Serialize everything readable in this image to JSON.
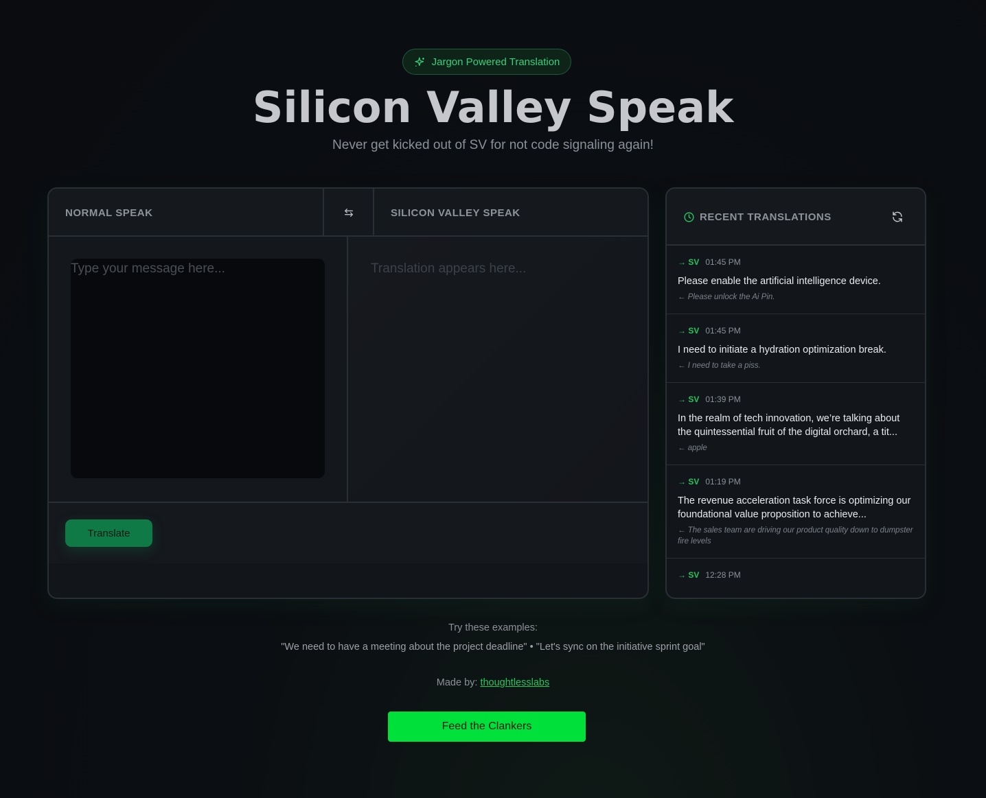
{
  "badge": {
    "label": "Jargon Powered Translation"
  },
  "header": {
    "title": "Silicon Valley Speak",
    "subtitle": "Never get kicked out of SV for not code signaling again!"
  },
  "translator": {
    "left_label": "NORMAL SPEAK",
    "right_label": "SILICON VALLEY SPEAK",
    "input_placeholder": "Type your message here...",
    "output_placeholder": "Translation appears here...",
    "translate_label": "Translate"
  },
  "recent": {
    "title": "RECENT TRANSLATIONS",
    "items": [
      {
        "tag": "→ SV",
        "time": "01:45 PM",
        "text": "Please enable the artificial intelligence device.",
        "original": "← Please unlock the Ai Pin."
      },
      {
        "tag": "→ SV",
        "time": "01:45 PM",
        "text": "I need to initiate a hydration optimization break.",
        "original": "← I need to take a piss."
      },
      {
        "tag": "→ SV",
        "time": "01:39 PM",
        "text": "In the realm of tech innovation, we’re talking about the quintessential fruit of the digital orchard, a tit...",
        "original": "← apple"
      },
      {
        "tag": "→ SV",
        "time": "01:19 PM",
        "text": "The revenue acceleration task force is optimizing our foundational value proposition to achieve...",
        "original": "← The sales team are driving our product quality down to dumpster fire levels"
      },
      {
        "tag": "→ SV",
        "time": "12:28 PM",
        "text": "",
        "original": ""
      }
    ]
  },
  "examples": {
    "label": "Try these examples:",
    "first": "\"We need to have a meeting about the project deadline\"",
    "separator": " • ",
    "second": "\"Let's sync on the initiative sprint goal\""
  },
  "footer": {
    "made_by": "Made by: ",
    "link": "thoughtlesslabs",
    "feed_label": "Feed the Clankers"
  },
  "colors": {
    "accent": "#22c55e",
    "button": "#00e03a",
    "background": "#0b0e12"
  }
}
